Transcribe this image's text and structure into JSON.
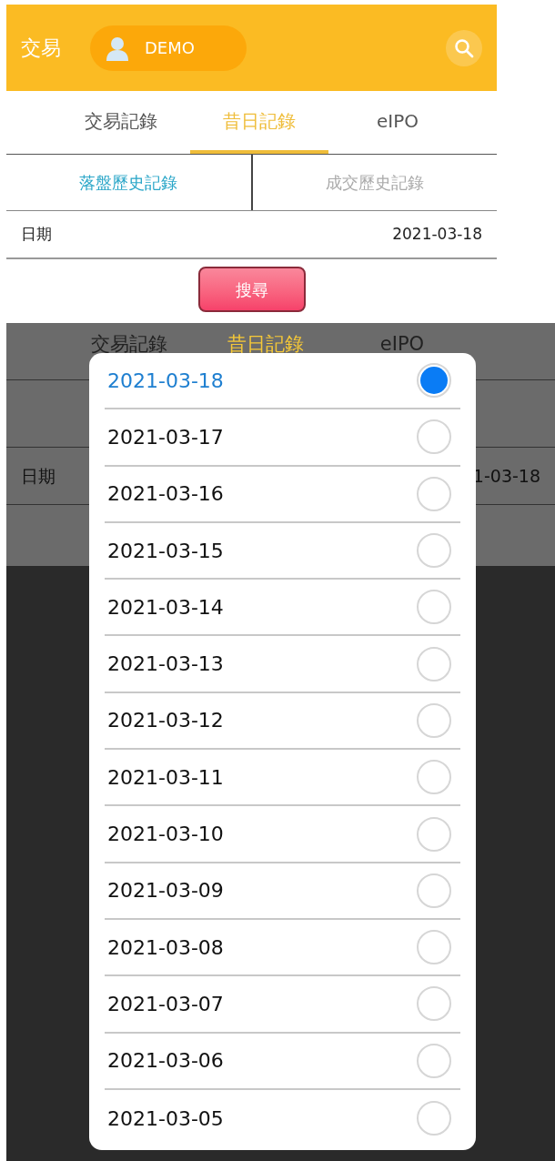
{
  "screen_1": {
    "header": {
      "title": "交易",
      "account": "DEMO"
    },
    "tabs": [
      {
        "label": "交易記錄",
        "selected": false
      },
      {
        "label": "昔日記錄",
        "selected": true
      },
      {
        "label": "eIPO",
        "selected": false
      }
    ],
    "subtabs": [
      {
        "label": "落盤歷史記錄",
        "selected": true
      },
      {
        "label": "成交歷史記錄",
        "selected": false
      }
    ],
    "date_field": {
      "label": "日期",
      "value": "2021-03-18"
    },
    "search_button": "搜尋"
  },
  "screen_2": {
    "tabs": [
      {
        "label": "交易記錄",
        "selected": false
      },
      {
        "label": "昔日記錄",
        "selected": true
      },
      {
        "label": "eIPO",
        "selected": false
      }
    ],
    "date_field": {
      "label": "日期",
      "value": "1-03-18"
    },
    "date_picker": [
      {
        "label": "2021-03-18",
        "selected": true
      },
      {
        "label": "2021-03-17",
        "selected": false
      },
      {
        "label": "2021-03-16",
        "selected": false
      },
      {
        "label": "2021-03-15",
        "selected": false
      },
      {
        "label": "2021-03-14",
        "selected": false
      },
      {
        "label": "2021-03-13",
        "selected": false
      },
      {
        "label": "2021-03-12",
        "selected": false
      },
      {
        "label": "2021-03-11",
        "selected": false
      },
      {
        "label": "2021-03-10",
        "selected": false
      },
      {
        "label": "2021-03-09",
        "selected": false
      },
      {
        "label": "2021-03-08",
        "selected": false
      },
      {
        "label": "2021-03-07",
        "selected": false
      },
      {
        "label": "2021-03-06",
        "selected": false
      },
      {
        "label": "2021-03-05",
        "selected": false
      }
    ]
  }
}
